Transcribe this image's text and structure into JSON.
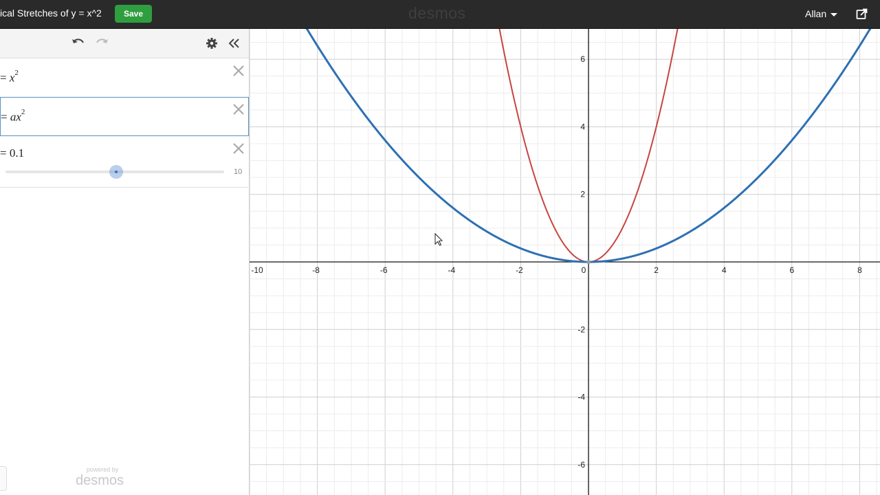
{
  "header": {
    "title": "ical Stretches of y = x^2",
    "save_label": "Save",
    "brand": "desmos",
    "user_name": "Allan"
  },
  "expressions": [
    {
      "prefix": "= ",
      "var": "x",
      "exp": "2",
      "color": "#2d70b3"
    },
    {
      "prefix": "= ",
      "var": "ax",
      "exp": "2",
      "color": "#c74440",
      "selected": true
    },
    {
      "prefix": "= ",
      "value": "0.1",
      "slider_max": "10",
      "slider_fraction": 0.5
    }
  ],
  "footer": {
    "powered_by": "powered by",
    "brand": "desmos"
  },
  "graph": {
    "x_ticks": [
      "-10",
      "-8",
      "-6",
      "-4",
      "-2",
      "0",
      "2",
      "4",
      "6",
      "8"
    ],
    "y_ticks": [
      "6",
      "4",
      "2",
      "-2",
      "-4",
      "-6"
    ],
    "x_range": [
      -10,
      8.6
    ],
    "y_range": [
      -6.9,
      6.9
    ],
    "curves": [
      {
        "expression": "y = x^2",
        "color": "#c74440"
      },
      {
        "expression": "y = 0.1 x^2",
        "color": "#2d70b3"
      }
    ]
  }
}
